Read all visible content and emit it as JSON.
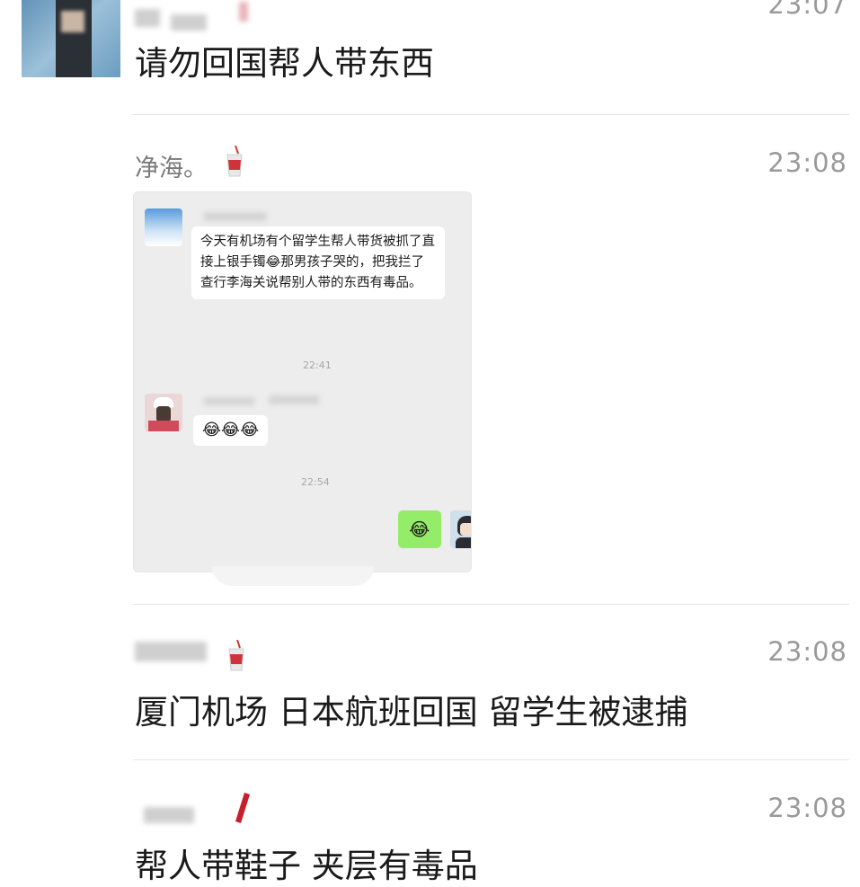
{
  "messages": [
    {
      "time": "23:07",
      "text": "请勿回国帮人带东西"
    },
    {
      "time": "23:08",
      "sender": "净海。",
      "attachment": {
        "received_text": "今天有机场有个留学生帮人带货被抓了直接上银手镯😂那男孩子哭的，把我拦了查行李海关说帮别人带的东西有毒品。",
        "time1": "22:41",
        "reply_emojis": "😂😂😂",
        "time2": "22:54",
        "sent_emoji": "😂"
      }
    },
    {
      "time": "23:08",
      "text": "厦门机场 日本航班回国 留学生被逮捕"
    },
    {
      "time": "23:08",
      "text": "帮人带鞋子  夹层有毒品"
    }
  ],
  "colors": {
    "sent_bubble": "#95ec69",
    "timestamp": "#9a9a9a",
    "divider": "#e4e4e4"
  },
  "icons": [
    "avatar",
    "drink-cup-icon",
    "laughing-emoji-icon"
  ]
}
